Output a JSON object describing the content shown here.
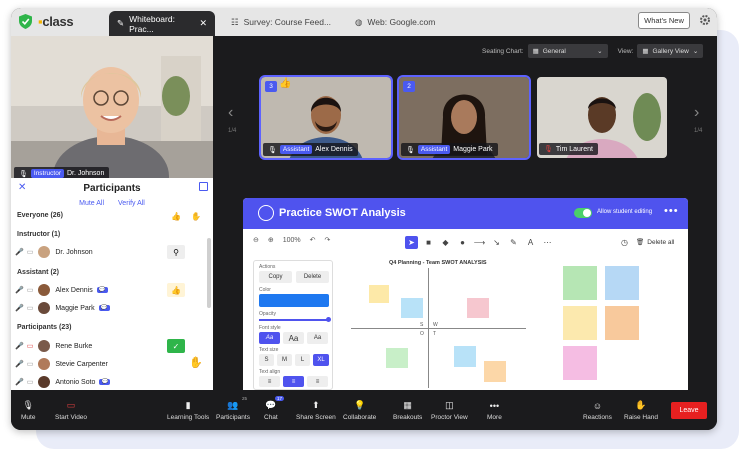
{
  "brand": {
    "name": "class",
    "accent": "#4f53ee",
    "leave_color": "#e62020"
  },
  "tabs": [
    {
      "label": "Whiteboard: Prac...",
      "active": true
    },
    {
      "label": "Survey: Course Feed...",
      "active": false
    },
    {
      "label": "Web: Google.com",
      "active": false
    }
  ],
  "header": {
    "whats_new": "What's New"
  },
  "self_view": {
    "role": "Instructor",
    "name": "Dr. Johnson"
  },
  "seating": {
    "label": "Seating Chart:",
    "value": "General",
    "view_label": "View:",
    "view_value": "Gallery View"
  },
  "gallery": {
    "page_left": "1/4",
    "page_right": "1/4",
    "tiles": [
      {
        "number": "3",
        "role": "Assistant",
        "name": "Alex Dennis",
        "reaction": "👍"
      },
      {
        "number": "2",
        "role": "Assistant",
        "name": "Maggie Park"
      },
      {
        "name": "Tim Laurent"
      }
    ]
  },
  "participants": {
    "title": "Participants",
    "mute_all": "Mute All",
    "verify_all": "Verify All",
    "everyone": "Everyone (26)",
    "instructor_header": "Instructor (1)",
    "instructor": {
      "name": "Dr. Johnson"
    },
    "assistant_header": "Assistant (2)",
    "assistants": [
      {
        "name": "Alex Dennis"
      },
      {
        "name": "Maggie Park"
      }
    ],
    "participants_header": "Participants (23)",
    "list": [
      {
        "name": "Rene Burke"
      },
      {
        "name": "Stevie Carpenter"
      },
      {
        "name": "Antonio Soto"
      }
    ]
  },
  "whiteboard": {
    "title": "Practice SWOT Analysis",
    "allow_editing": "Allow student editing",
    "zoom": "100%",
    "delete_all": "Delete all",
    "props": {
      "actions": "Actions",
      "copy": "Copy",
      "delete": "Delete",
      "color": "Color",
      "opacity": "Opacity",
      "font_style": "Font style",
      "text_size": "Text size",
      "sizes": [
        "S",
        "M",
        "L",
        "XL"
      ],
      "text_align": "Text align"
    },
    "canvas_title": "Q4 Planning - Team SWOT ANALYSIS",
    "quadrants": [
      "S",
      "W",
      "O",
      "T"
    ]
  },
  "toolbar": {
    "mute": "Mute",
    "start_video": "Start Video",
    "learning_tools": "Learning Tools",
    "participants": "Participants",
    "participants_count": "25",
    "chat": "Chat",
    "chat_count": "17",
    "share_screen": "Share Screen",
    "collaborate": "Collaborate",
    "breakouts": "Breakouts",
    "proctor_view": "Proctor View",
    "more": "More",
    "reactions": "Reactions",
    "raise_hand": "Raise Hand",
    "leave": "Leave"
  }
}
